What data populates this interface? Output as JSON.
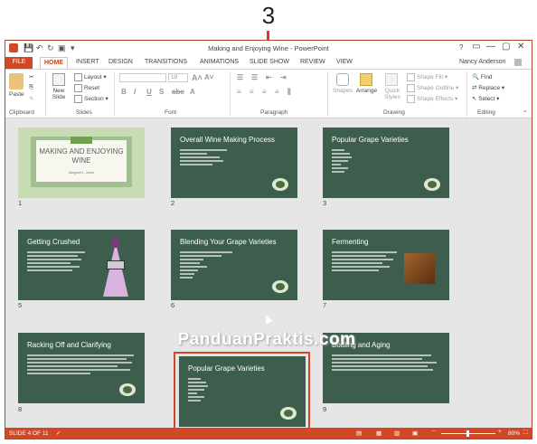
{
  "callout": "3",
  "window": {
    "title": "Making and Enjoying Wine - PowerPoint",
    "controls": [
      "?",
      "▭",
      "—",
      "▢",
      "✕"
    ]
  },
  "tabs": [
    "FILE",
    "HOME",
    "INSERT",
    "DESIGN",
    "TRANSITIONS",
    "ANIMATIONS",
    "SLIDE SHOW",
    "REVIEW",
    "VIEW"
  ],
  "user": "Nancy Anderson",
  "ribbon": {
    "clipboard": {
      "paste": "Paste",
      "label": "Clipboard"
    },
    "slides": {
      "new_slide": "New Slide",
      "layout": "Layout",
      "reset": "Reset",
      "section": "Section",
      "label": "Slides"
    },
    "font": {
      "label": "Font",
      "size": "18"
    },
    "paragraph": {
      "label": "Paragraph"
    },
    "drawing": {
      "shapes": "Shapes",
      "arrange": "Arrange",
      "quick_styles": "Quick Styles",
      "shape_fill": "Shape Fill",
      "shape_outline": "Shape Outline",
      "shape_effects": "Shape Effects",
      "label": "Drawing"
    },
    "editing": {
      "find": "Find",
      "replace": "Replace",
      "select": "Select",
      "label": "Editing"
    }
  },
  "slides": [
    {
      "num": "1",
      "title": "MAKING AND ENJOYING WINE",
      "subtitle": "Margaret L. Jones"
    },
    {
      "num": "2",
      "title": "Overall Wine Making Process"
    },
    {
      "num": "3",
      "title": "Popular Grape Varieties"
    },
    {
      "num": "5",
      "title": "Getting Crushed"
    },
    {
      "num": "6",
      "title": "Blending Your Grape Varieties"
    },
    {
      "num": "7",
      "title": "Fermenting"
    },
    {
      "num": "8",
      "title": "Racking Off and Clarifying"
    },
    {
      "num": "4",
      "title": "Popular Grape Varieties"
    },
    {
      "num": "9",
      "title": "Bottling and Aging"
    }
  ],
  "watermark": "PanduanPraktis.com",
  "status": {
    "slide_info": "SLIDE 4 OF 11",
    "zoom": "80%"
  }
}
